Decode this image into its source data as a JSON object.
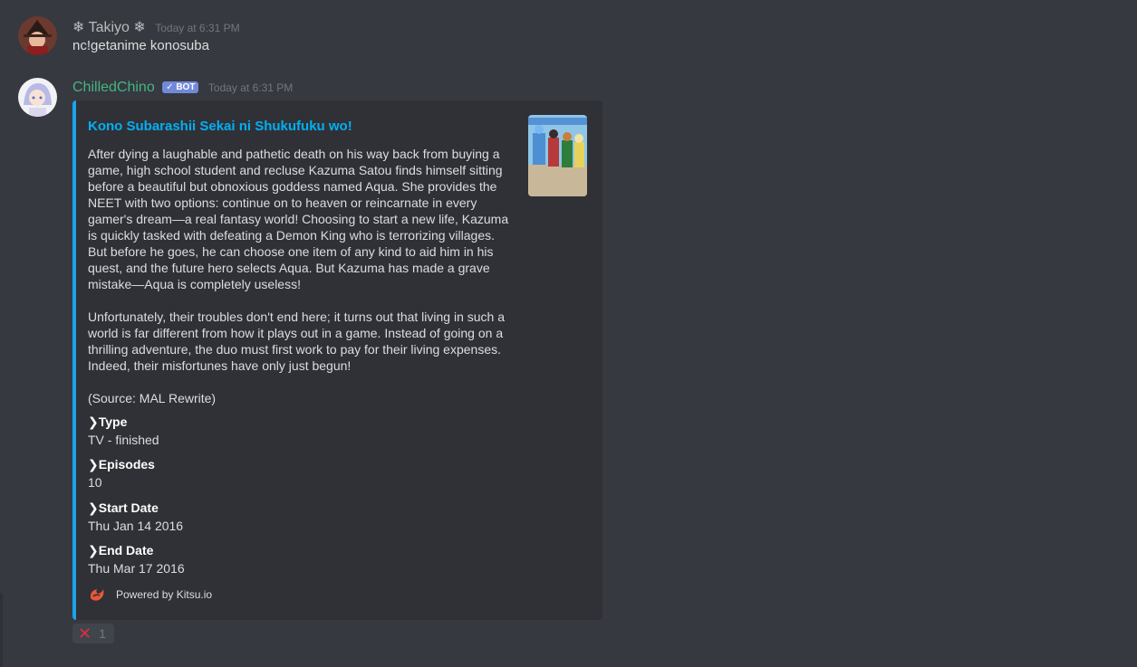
{
  "messages": [
    {
      "username": "❄ Takiyo ❄",
      "timestamp": "Today at 6:31 PM",
      "content": "nc!getanime konosuba",
      "username_color": "#b9bbbe"
    },
    {
      "username": "ChilledChino",
      "bot_tag": "✓ BOT",
      "timestamp": "Today at 6:31 PM",
      "username_color": "#43b581",
      "embed": {
        "title": "Kono Subarashii Sekai ni Shukufuku wo!",
        "description": "After dying a laughable and pathetic death on his way back from buying a game, high school student and recluse Kazuma Satou finds himself sitting before a beautiful but obnoxious goddess named Aqua. She provides the NEET with two options: continue on to heaven or reincarnate in every gamer's dream—a real fantasy world! Choosing to start a new life, Kazuma is quickly tasked with defeating a Demon King who is terrorizing villages. But before he goes, he can choose one item of any kind to aid him in his quest, and the future hero selects Aqua. But Kazuma has made a grave mistake—Aqua is completely useless!\n\nUnfortunately, their troubles don't end here; it turns out that living in such a world is far different from how it plays out in a game. Instead of going on a thrilling adventure, the duo must first work to pay for their living expenses. Indeed, their misfortunes have only just begun!\n\n(Source: MAL Rewrite)",
        "fields": [
          {
            "name": "❯Type",
            "value": "TV - finished"
          },
          {
            "name": "❯Episodes",
            "value": "10"
          },
          {
            "name": "❯Start Date",
            "value": "Thu Jan 14 2016"
          },
          {
            "name": "❯End Date",
            "value": "Thu Mar 17 2016"
          }
        ],
        "footer": "Powered by Kitsu.io",
        "accent_color": "#1da2ea"
      }
    }
  ],
  "reaction": {
    "emoji": "✕",
    "count": "1"
  }
}
